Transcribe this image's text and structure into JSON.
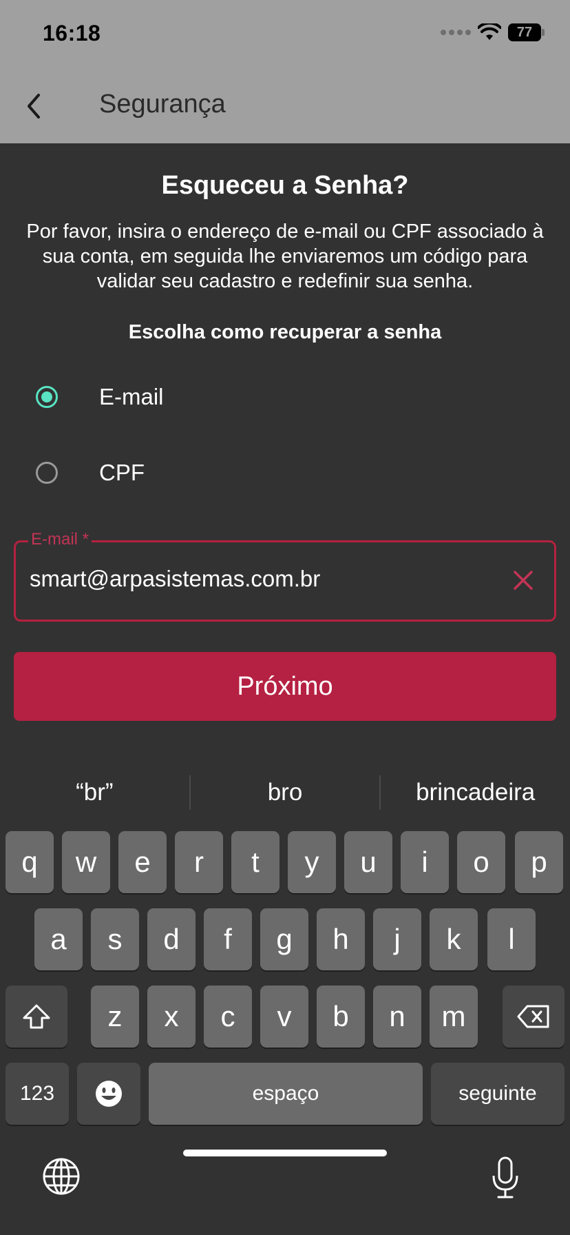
{
  "status_bar": {
    "time": "16:18",
    "battery": "77"
  },
  "nav": {
    "title": "Segurança"
  },
  "form": {
    "heading": "Esqueceu a Senha?",
    "description": "Por favor, insira o endereço de e-mail ou CPF associado à sua conta, em seguida lhe enviaremos um código para validar seu cadastro e redefinir sua senha.",
    "choose_label": "Escolha como recuperar a senha",
    "options": [
      {
        "label": "E-mail",
        "selected": true
      },
      {
        "label": "CPF",
        "selected": false
      }
    ],
    "email_field": {
      "label": "E-mail *",
      "value": "smart@arpasistemas.com.br"
    },
    "next_button": "Próximo"
  },
  "keyboard": {
    "suggestions": [
      "“br”",
      "bro",
      "brincadeira"
    ],
    "row1": [
      "q",
      "w",
      "e",
      "r",
      "t",
      "y",
      "u",
      "i",
      "o",
      "p"
    ],
    "row2": [
      "a",
      "s",
      "d",
      "f",
      "g",
      "h",
      "j",
      "k",
      "l"
    ],
    "row3": [
      "z",
      "x",
      "c",
      "v",
      "b",
      "n",
      "m"
    ],
    "numbers_key": "123",
    "space_key": "espaço",
    "return_key": "seguinte"
  },
  "colors": {
    "accent": "#b52142",
    "radio_selected": "#59e3c2",
    "header_bg": "#a0a0a0",
    "background": "#323232"
  }
}
